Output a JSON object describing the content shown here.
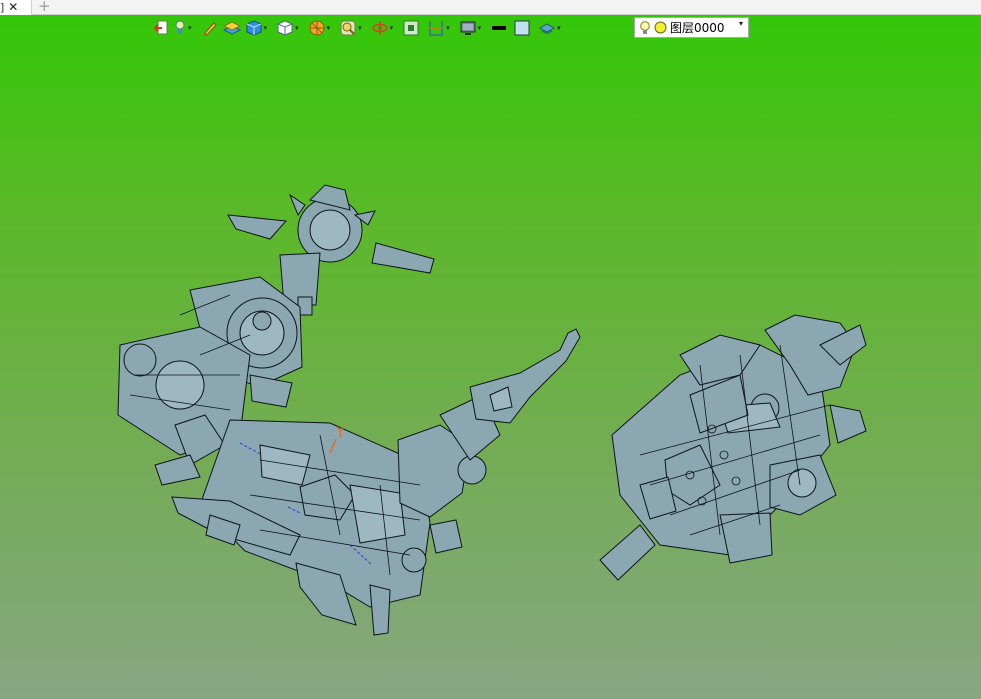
{
  "tabs": [
    {
      "label": "]",
      "close_glyph": "✕"
    }
  ],
  "new_tab_glyph": "+",
  "toolbar": {
    "buttons": [
      {
        "name": "exit-icon",
        "dropdown": false
      },
      {
        "name": "bulb-dropdown-icon",
        "dropdown": true
      },
      {
        "name": "pen-icon",
        "dropdown": false
      },
      {
        "name": "layers-icon",
        "dropdown": false
      },
      {
        "name": "cube-shaded-icon",
        "dropdown": true
      },
      {
        "name": "cube-view-icon",
        "dropdown": true
      },
      {
        "name": "render-mode-icon",
        "dropdown": true
      },
      {
        "name": "zoom-icon",
        "dropdown": true
      },
      {
        "name": "rotate-icon",
        "dropdown": true
      },
      {
        "name": "fit-view-icon",
        "dropdown": false
      },
      {
        "name": "section-icon",
        "dropdown": true
      },
      {
        "name": "display-icon",
        "dropdown": true
      },
      {
        "name": "line-color-icon",
        "dropdown": false
      },
      {
        "name": "fill-color-icon",
        "dropdown": false
      },
      {
        "name": "layer-style-icon",
        "dropdown": true
      }
    ],
    "dropdown_glyph": "▾",
    "layer_select": {
      "value": "图层0000",
      "arrow": "▾"
    }
  },
  "viewport": {
    "background_top": "#33c708",
    "background_bottom": "#87a682",
    "axis_label": "Y"
  },
  "colors": {
    "part_fill": "#8aa7b2",
    "part_stroke": "#0e1418",
    "axis_y": "#e0701a"
  }
}
